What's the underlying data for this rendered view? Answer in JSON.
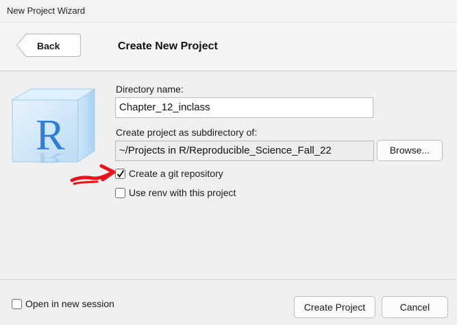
{
  "window": {
    "title": "New Project Wizard"
  },
  "header": {
    "back_label": "Back",
    "page_title": "Create New Project"
  },
  "form": {
    "directory_name_label": "Directory name:",
    "directory_name_value": "Chapter_12_inclass",
    "subdirectory_label": "Create project as subdirectory of:",
    "subdirectory_value": "~/Projects in R/Reproducible_Science_Fall_22",
    "browse_label": "Browse...",
    "git_label": "Create a git repository",
    "git_checked": true,
    "renv_label": "Use renv with this project",
    "renv_checked": false
  },
  "footer": {
    "new_session_label": "Open in new session",
    "new_session_checked": false,
    "create_label": "Create Project",
    "cancel_label": "Cancel"
  },
  "colors": {
    "annotation_arrow": "#e8141b",
    "r_logo_blue": "#2f7ed8"
  }
}
